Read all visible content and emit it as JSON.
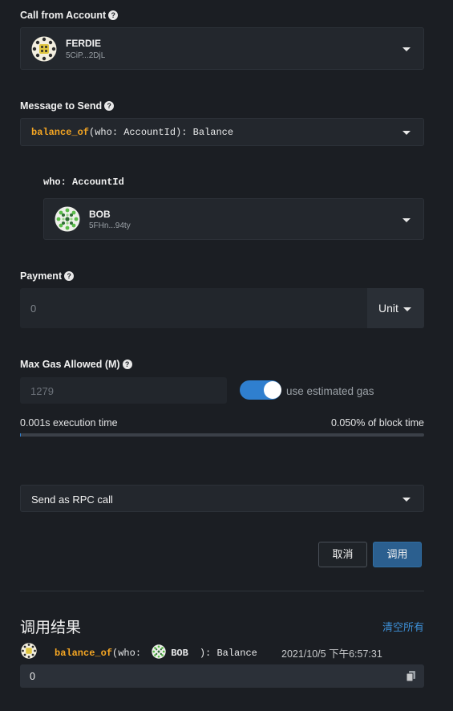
{
  "call_from": {
    "label": "Call from Account",
    "name": "FERDIE",
    "address": "5CiP...2DjL"
  },
  "message": {
    "label": "Message to Send",
    "fn_name": "balance_of",
    "signature": "(who: AccountId): Balance"
  },
  "param": {
    "label": "who: AccountId",
    "name": "BOB",
    "address": "5FHn...94ty"
  },
  "payment": {
    "label": "Payment",
    "value": "0",
    "unit": "Unit"
  },
  "gas": {
    "label": "Max Gas Allowed (M)",
    "value": "1279",
    "toggle_label": "use estimated gas",
    "toggle_on": true,
    "execution_time": "0.001s execution time",
    "block_time": "0.050% of block time"
  },
  "send_mode": {
    "value": "Send as RPC call"
  },
  "actions": {
    "cancel": "取消",
    "call": "调用"
  },
  "results": {
    "title": "调用结果",
    "clear_all": "清空所有",
    "fn_name": "balance_of",
    "open": "(who:",
    "who": "BOB",
    "close": "): Balance",
    "timestamp": "2021/10/5 下午6:57:31",
    "value": "0"
  },
  "colors": {
    "accent": "#2f7fcf",
    "fn": "#f5a623",
    "link": "#3d8fd6"
  }
}
